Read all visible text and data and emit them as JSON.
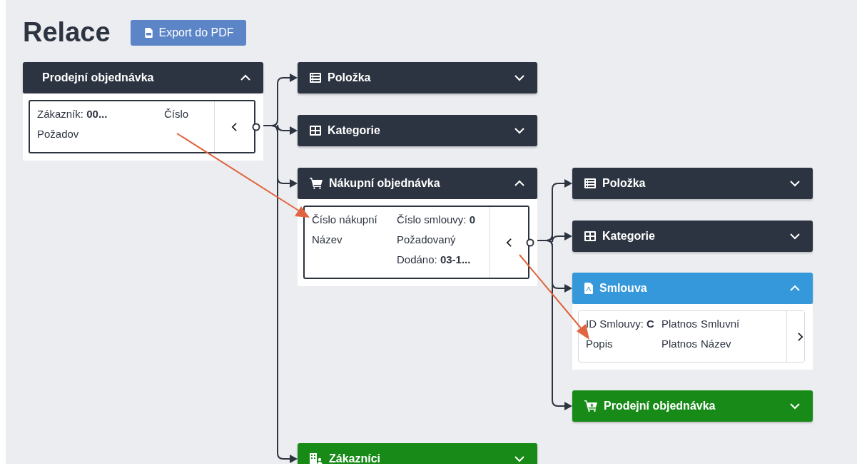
{
  "title": "Relace",
  "export_button": {
    "label": "Export do PDF"
  },
  "nodes": [
    {
      "title": "Prodejní objednávka",
      "color": "#2d3441",
      "expanded": true,
      "card": {
        "selected": true,
        "linked": true,
        "columns": [
          [
            "Zákazník:  **00...**",
            "Požadov"
          ],
          [
            "Číslo"
          ]
        ]
      }
    },
    {
      "title": "Položka",
      "color": "#2d3441",
      "expanded": false
    },
    {
      "title": "Kategorie",
      "color": "#2d3441",
      "expanded": false
    },
    {
      "title": "Nákupní objednávka",
      "color": "#2d3441",
      "expanded": true,
      "card": {
        "selected": true,
        "linked": true,
        "columns": [
          [
            "Číslo nákupní",
            "Název"
          ],
          [
            "Číslo smlouvy: **0**",
            "Požadovaný",
            "Dodáno: **03-1...**"
          ]
        ]
      }
    },
    {
      "title": "Položka",
      "color": "#2d3441",
      "expanded": false
    },
    {
      "title": "Kategorie",
      "color": "#2d3441",
      "expanded": false
    },
    {
      "title": "Smlouva",
      "color": "#3498db",
      "expanded": true,
      "card": {
        "selected": false,
        "linked": false,
        "columns": [
          [
            "ID Smlouvy: **C**",
            "Popis"
          ],
          [
            "Platnos",
            "Platnos"
          ],
          [
            "Smluvní",
            "Název"
          ]
        ]
      }
    },
    {
      "title": "Prodejní objednávka",
      "color": "#178a17",
      "expanded": false
    },
    {
      "title": "Zákazníci",
      "color": "#178a17",
      "expanded": false
    }
  ]
}
